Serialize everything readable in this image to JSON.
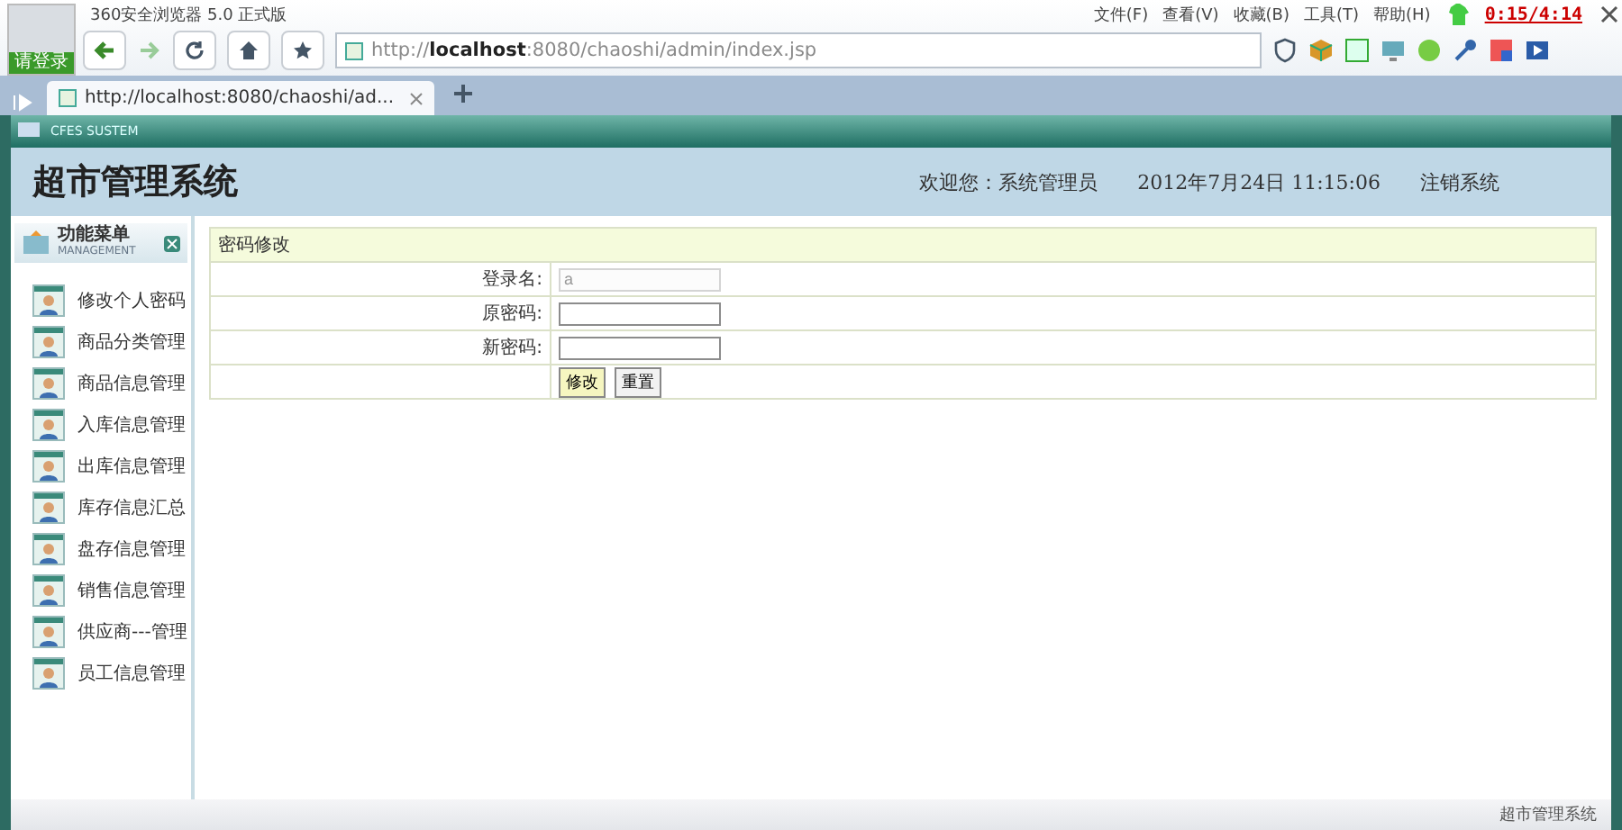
{
  "browser": {
    "title": "360安全浏览器 5.0 正式版",
    "login_label": "请登录",
    "menu": [
      "文件(F)",
      "查看(V)",
      "收藏(B)",
      "工具(T)",
      "帮助(H)"
    ],
    "recording_timer": "0:15/4:14",
    "address": {
      "prefix": "http://",
      "host": "localhost",
      "rest": ":8080/chaoshi/admin/index.jsp"
    },
    "tabs": [
      {
        "label": "http://localhost:8080/chaoshi/ad...",
        "selected": true
      }
    ]
  },
  "app": {
    "frame_title": "CFES SUSTEM",
    "title": "超市管理系统",
    "welcome": "欢迎您：系统管理员",
    "date": "2012年7月24日  11:15:06",
    "logout": "注销系统",
    "sidebar": {
      "title": "功能菜单",
      "subtitle": "MANAGEMENT",
      "items": [
        {
          "label": "修改个人密码"
        },
        {
          "label": "商品分类管理"
        },
        {
          "label": "商品信息管理"
        },
        {
          "label": "入库信息管理"
        },
        {
          "label": "出库信息管理"
        },
        {
          "label": "库存信息汇总"
        },
        {
          "label": "盘存信息管理"
        },
        {
          "label": "销售信息管理"
        },
        {
          "label": "供应商---管理"
        },
        {
          "label": "员工信息管理"
        }
      ]
    },
    "form": {
      "title": "密码修改",
      "fields": [
        {
          "label": "登录名:",
          "value": "a",
          "disabled": true
        },
        {
          "label": "原密码:",
          "disabled": false
        },
        {
          "label": "新密码:",
          "disabled": false
        }
      ],
      "buttons": [
        {
          "label": "修改",
          "selected": true
        },
        {
          "label": "重置",
          "selected": false
        }
      ]
    },
    "status": "超市管理系统"
  }
}
